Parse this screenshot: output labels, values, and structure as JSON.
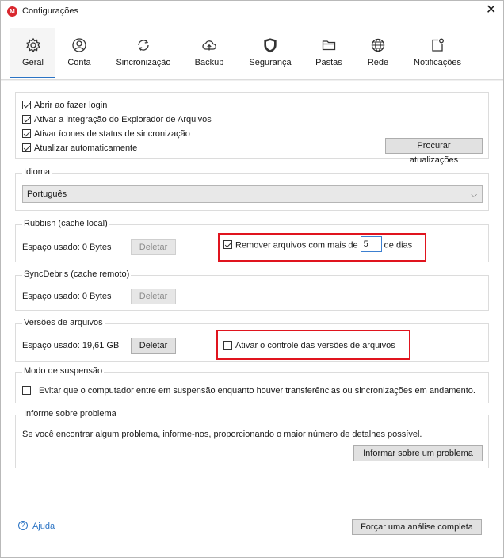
{
  "window": {
    "title": "Configurações",
    "app_icon": "M"
  },
  "tabs": [
    {
      "label": "Geral",
      "icon": "gear-icon"
    },
    {
      "label": "Conta",
      "icon": "user-icon"
    },
    {
      "label": "Sincronização",
      "icon": "sync-icon"
    },
    {
      "label": "Backup",
      "icon": "cloud-upload-icon"
    },
    {
      "label": "Segurança",
      "icon": "shield-icon"
    },
    {
      "label": "Pastas",
      "icon": "folder-icon"
    },
    {
      "label": "Rede",
      "icon": "globe-icon"
    },
    {
      "label": "Notificações",
      "icon": "bell-icon"
    }
  ],
  "active_tab": "Geral",
  "general": {
    "options": [
      {
        "label": "Abrir ao fazer login",
        "checked": true
      },
      {
        "label": "Ativar a integração do Explorador de Arquivos",
        "checked": true
      },
      {
        "label": "Ativar ícones de status de sincronização",
        "checked": true
      },
      {
        "label": "Atualizar automaticamente",
        "checked": true
      }
    ],
    "check_updates_label": "Procurar atualizações"
  },
  "language": {
    "legend": "Idioma",
    "selected": "Português"
  },
  "rubbish": {
    "legend": "Rubbish (cache local)",
    "space_used": "Espaço usado: 0 Bytes",
    "delete_label": "Deletar",
    "remove_label": "Remover arquivos com mais de",
    "remove_checked": true,
    "days_value": "5",
    "days_label": "de dias"
  },
  "syncdebris": {
    "legend": "SyncDebris (cache remoto)",
    "space_used": "Espaço usado: 0 Bytes",
    "delete_label": "Deletar"
  },
  "versions": {
    "legend": "Versões de arquivos",
    "space_used": "Espaço usado: 19,61 GB",
    "delete_label": "Deletar",
    "control_label": "Ativar o controle das versões de arquivos",
    "control_checked": false
  },
  "sleep": {
    "legend": "Modo de suspensão",
    "label": "Evitar que o computador entre em suspensão enquanto houver transferências ou sincronizações em andamento.",
    "checked": false
  },
  "report": {
    "legend": "Informe sobre problema",
    "text": "Se você encontrar algum problema, informe-nos, proporcionando o maior número de detalhes possível.",
    "button_label": "Informar sobre um problema"
  },
  "footer": {
    "help_label": "Ajuda",
    "help_icon": "?",
    "full_scan_label": "Forçar uma análise completa"
  },
  "colors": {
    "accent": "#2a73c4",
    "highlight": "#e0141e",
    "brand": "#d9272e"
  }
}
